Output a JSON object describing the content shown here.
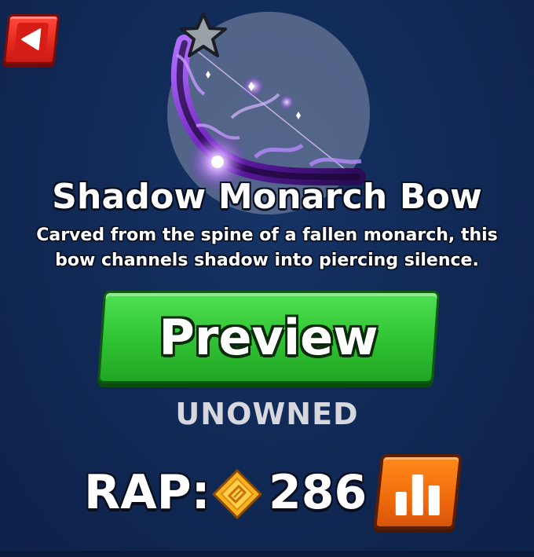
{
  "item": {
    "name": "Shadow Monarch Bow",
    "description": "Carved from the spine of a fallen monarch, this bow channels shadow into piercing silence.",
    "status": "UNOWNED",
    "favorite_icon": "star-icon",
    "art_icon": "shadow-bow-art"
  },
  "actions": {
    "back_icon": "back-arrow-icon",
    "preview_label": "Preview",
    "stats_icon": "bar-chart-icon"
  },
  "rap": {
    "label": "RAP:",
    "currency_icon": "coin-icon",
    "value": "286"
  },
  "colors": {
    "background": "#112a57",
    "back_button": "#e2281f",
    "preview_button": "#2fc232",
    "stats_button": "#f06b0c",
    "status_text": "#d6d8dd",
    "coin": "#f5b321"
  }
}
